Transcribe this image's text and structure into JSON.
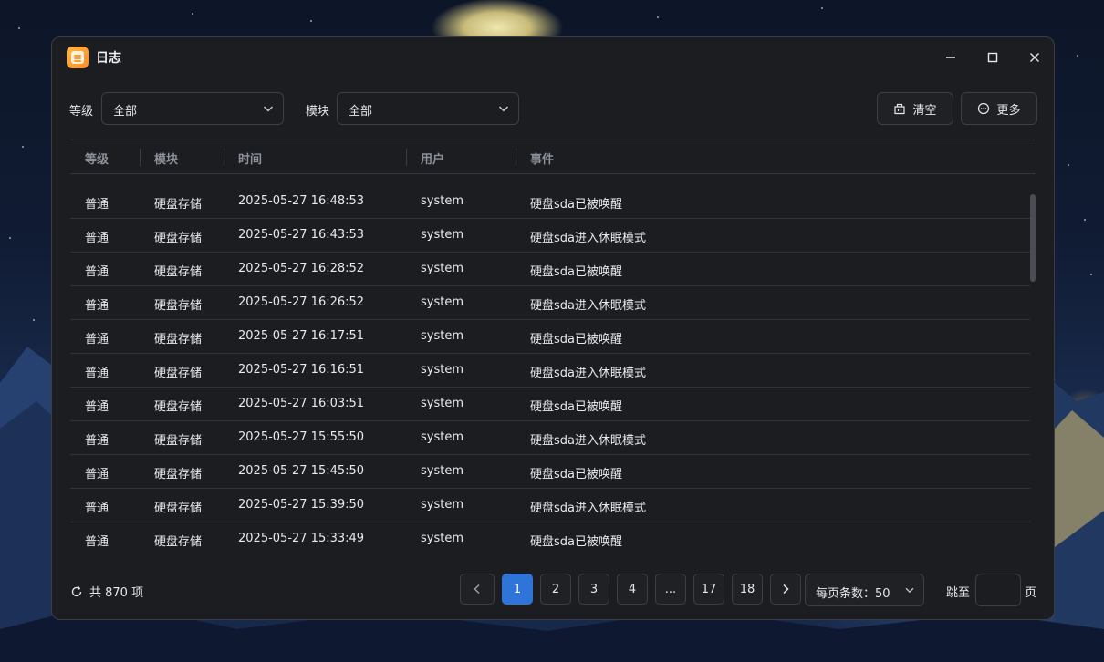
{
  "window": {
    "title": "日志"
  },
  "filters": {
    "level_label": "等级",
    "level_value": "全部",
    "module_label": "模块",
    "module_value": "全部"
  },
  "actions": {
    "clear_label": "清空",
    "more_label": "更多"
  },
  "table": {
    "columns": [
      "等级",
      "模块",
      "时间",
      "用户",
      "事件"
    ],
    "rows": [
      [
        "普通",
        "硬盘存储",
        "2025-05-27 16:48:53",
        "system",
        "硬盘sda已被唤醒"
      ],
      [
        "普通",
        "硬盘存储",
        "2025-05-27 16:43:53",
        "system",
        "硬盘sda进入休眠模式"
      ],
      [
        "普通",
        "硬盘存储",
        "2025-05-27 16:28:52",
        "system",
        "硬盘sda已被唤醒"
      ],
      [
        "普通",
        "硬盘存储",
        "2025-05-27 16:26:52",
        "system",
        "硬盘sda进入休眠模式"
      ],
      [
        "普通",
        "硬盘存储",
        "2025-05-27 16:17:51",
        "system",
        "硬盘sda已被唤醒"
      ],
      [
        "普通",
        "硬盘存储",
        "2025-05-27 16:16:51",
        "system",
        "硬盘sda进入休眠模式"
      ],
      [
        "普通",
        "硬盘存储",
        "2025-05-27 16:03:51",
        "system",
        "硬盘sda已被唤醒"
      ],
      [
        "普通",
        "硬盘存储",
        "2025-05-27 15:55:50",
        "system",
        "硬盘sda进入休眠模式"
      ],
      [
        "普通",
        "硬盘存储",
        "2025-05-27 15:45:50",
        "system",
        "硬盘sda已被唤醒"
      ],
      [
        "普通",
        "硬盘存储",
        "2025-05-27 15:39:50",
        "system",
        "硬盘sda进入休眠模式"
      ],
      [
        "普通",
        "硬盘存储",
        "2025-05-27 15:33:49",
        "system",
        "硬盘sda已被唤醒"
      ]
    ]
  },
  "footer": {
    "total_text": "共 870 项",
    "pages": [
      "1",
      "2",
      "3",
      "4",
      "...",
      "17",
      "18"
    ],
    "current_page": "1",
    "page_size_text": "每页条数：50",
    "jump_label": "跳至",
    "jump_suffix": "页",
    "jump_value": ""
  },
  "colors": {
    "accent": "#2f74d9",
    "window_bg": "#1b1d21",
    "app_icon": "#ff9a2c"
  },
  "icons": {
    "app": "log-app-icon",
    "minimize": "minimize-icon",
    "maximize": "maximize-icon",
    "close": "close-icon",
    "clear": "trash-icon",
    "more": "more-dots-icon",
    "refresh": "refresh-icon"
  }
}
